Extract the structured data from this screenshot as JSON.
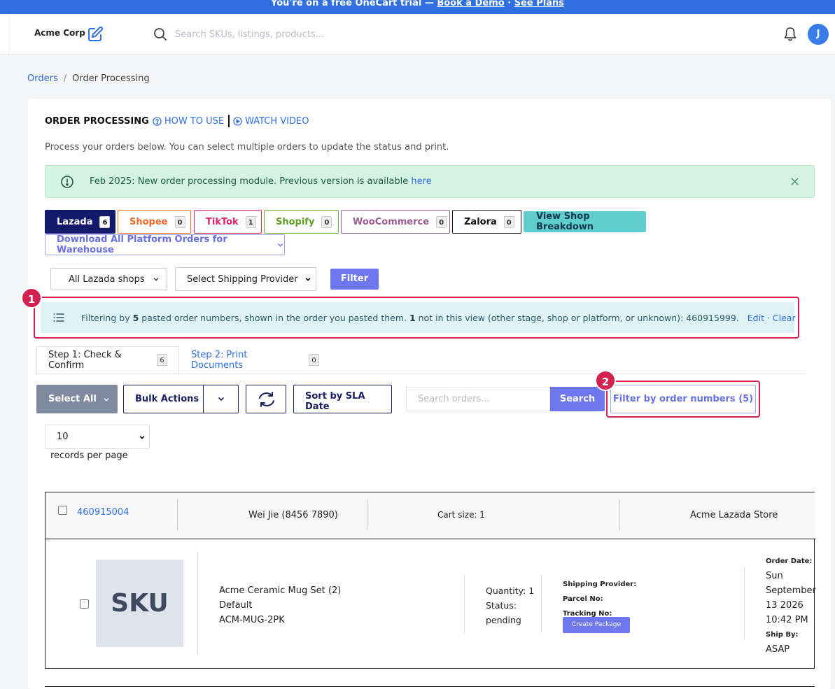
{
  "banner": {
    "text": "You're on a free OneCart trial — ",
    "book_demo": "Book a Demo",
    "dot": " · ",
    "see_plans": "See Plans"
  },
  "header": {
    "company": "Acme Corp",
    "search_placeholder": "Search SKUs, listings, products...",
    "avatar_initial": "J"
  },
  "breadcrumb": {
    "root": "Orders",
    "sep": "/",
    "current": "Order Processing"
  },
  "page": {
    "title": "ORDER PROCESSING",
    "how_to_use": "HOW TO USE",
    "watch_video": "WATCH VIDEO",
    "description": "Process your orders below. You can select multiple orders to update the status and print."
  },
  "alert": {
    "text": "Feb 2025: New order processing module. Previous version is available ",
    "link": "here",
    "close": "✕"
  },
  "platforms": [
    {
      "label": "Lazada",
      "count": "6",
      "color": "#ffffff",
      "border": "#141a6b",
      "bg": "#141a6b"
    },
    {
      "label": "Shopee",
      "count": "0",
      "color": "#ee6a2a",
      "border": "#ee6a2a",
      "bg": "#ffffff"
    },
    {
      "label": "TikTok",
      "count": "1",
      "color": "#e0226a",
      "border": "#e0226a",
      "bg": "#ffffff"
    },
    {
      "label": "Shopify",
      "count": "0",
      "color": "#5f9e23",
      "border": "#6ab02d",
      "bg": "#ffffff"
    },
    {
      "label": "WooCommerce",
      "count": "0",
      "color": "#9b5c8f",
      "border": "#9b5c8f",
      "bg": "#ffffff"
    },
    {
      "label": "Zalora",
      "count": "0",
      "color": "#111111",
      "border": "#111111",
      "bg": "#ffffff"
    }
  ],
  "view_breakdown": "View Shop Breakdown",
  "download_all": "Download All Platform Orders for Warehouse",
  "filters": {
    "shops": "All Lazada shops",
    "shipping": "Select Shipping Provider",
    "filter_btn": "Filter"
  },
  "info_bar": {
    "pre": "Filtering by ",
    "count": "5",
    "mid": " pasted order numbers, shown in the order you pasted them. ",
    "missing_count": "1",
    "post": " not in this view (other stage, shop or platform, or unknown): 460915999.",
    "edit": "Edit",
    "dot": " · ",
    "clear": "Clear"
  },
  "badges": {
    "one": "1",
    "two": "2"
  },
  "tabs": [
    {
      "label": "Step 1: Check & Confirm",
      "count": "6"
    },
    {
      "label": "Step 2: Print Documents",
      "count": "0"
    }
  ],
  "toolbar": {
    "select_all": "Select All",
    "bulk_actions": "Bulk Actions",
    "sort": "Sort by SLA Date",
    "search_placeholder": "Search orders...",
    "search_btn": "Search",
    "filter_by_numbers": "Filter by order numbers (5)"
  },
  "pagination": {
    "per_page_value": "10",
    "per_page_label": "records per page"
  },
  "order": {
    "id": "460915004",
    "customer": "Wei Jie (8456 7890)",
    "cart": "Cart size: 1",
    "store": "Acme Lazada Store",
    "sku_placeholder": "SKU",
    "product_name": "Acme Ceramic Mug Set (2)",
    "variant": "Default",
    "sku": "ACM-MUG-2PK",
    "quantity": "Quantity: 1",
    "status_label": "Status:",
    "status": "pending",
    "shipping_provider_label": "Shipping Provider:",
    "parcel_label": "Parcel No:",
    "tracking_label": "Tracking No:",
    "create_package": "Create Package",
    "order_date_label": "Order Date:",
    "order_date_day": "Sun",
    "order_date_month": "September",
    "order_date_date": "13 2026",
    "order_time": "10:42 PM",
    "ship_by_label": "Ship By:",
    "ship_by": "ASAP"
  }
}
